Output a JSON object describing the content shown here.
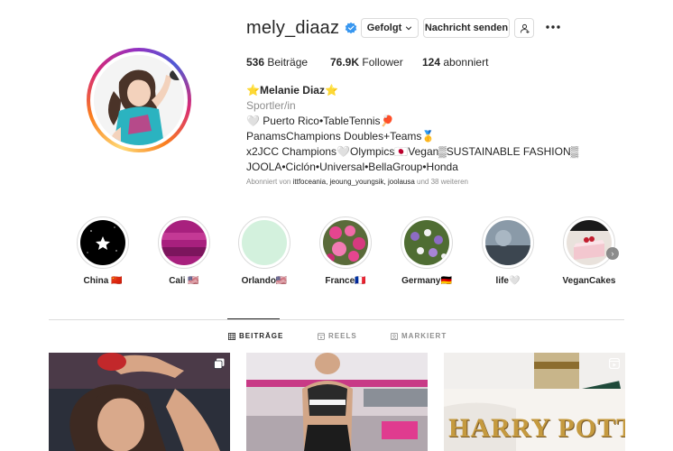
{
  "profile": {
    "username": "mely_diaaz",
    "follow_button": "Gefolgt",
    "message_button": "Nachricht senden",
    "stats": {
      "posts_count": "536",
      "posts_label": "Beiträge",
      "followers_count": "76.9K",
      "followers_label": "Follower",
      "following_count": "124",
      "following_label": "abonniert"
    },
    "bio": {
      "name": "⭐Melanie Diaz⭐",
      "category": "Sportler/in",
      "line1": "🤍 Puerto Rico•TableTennis🏓",
      "line2": "PanamsChampions Doubles+Teams🥇",
      "line3": "x2JCC Champions🤍Olympics🇯🇵Vegan▒SUSTAINABLE FASHION▒",
      "line4": "JOOLA•Ciclón•Universal•BellaGroup•Honda"
    },
    "followed_by": {
      "prefix": "Abonniert von ",
      "users": "ittfoceania, jeoung_youngsik, joolausa",
      "suffix": " und 38 weiteren"
    }
  },
  "highlights": [
    {
      "label": "China 🇨🇳"
    },
    {
      "label": "Cali 🇺🇸"
    },
    {
      "label": "Orlando🇺🇸"
    },
    {
      "label": "France🇫🇷"
    },
    {
      "label": "Germany🇩🇪"
    },
    {
      "label": "life🤍"
    },
    {
      "label": "VeganCakes"
    }
  ],
  "tabs": [
    {
      "label": "BEITRÄGE",
      "icon": "grid-icon",
      "active": true
    },
    {
      "label": "REELS",
      "icon": "reels-icon",
      "active": false
    },
    {
      "label": "MARKIERT",
      "icon": "tagged-icon",
      "active": false
    }
  ],
  "posts": [
    {
      "icon": "multiple-photos-icon"
    },
    {
      "icon": "none"
    },
    {
      "icon": "reel-icon",
      "overlay_text": "HARRY POTTER"
    }
  ],
  "colors": {
    "accent_blue": "#3897f0",
    "text_primary": "#262626",
    "text_secondary": "#8e8e8e",
    "border": "#dbdbdb"
  }
}
